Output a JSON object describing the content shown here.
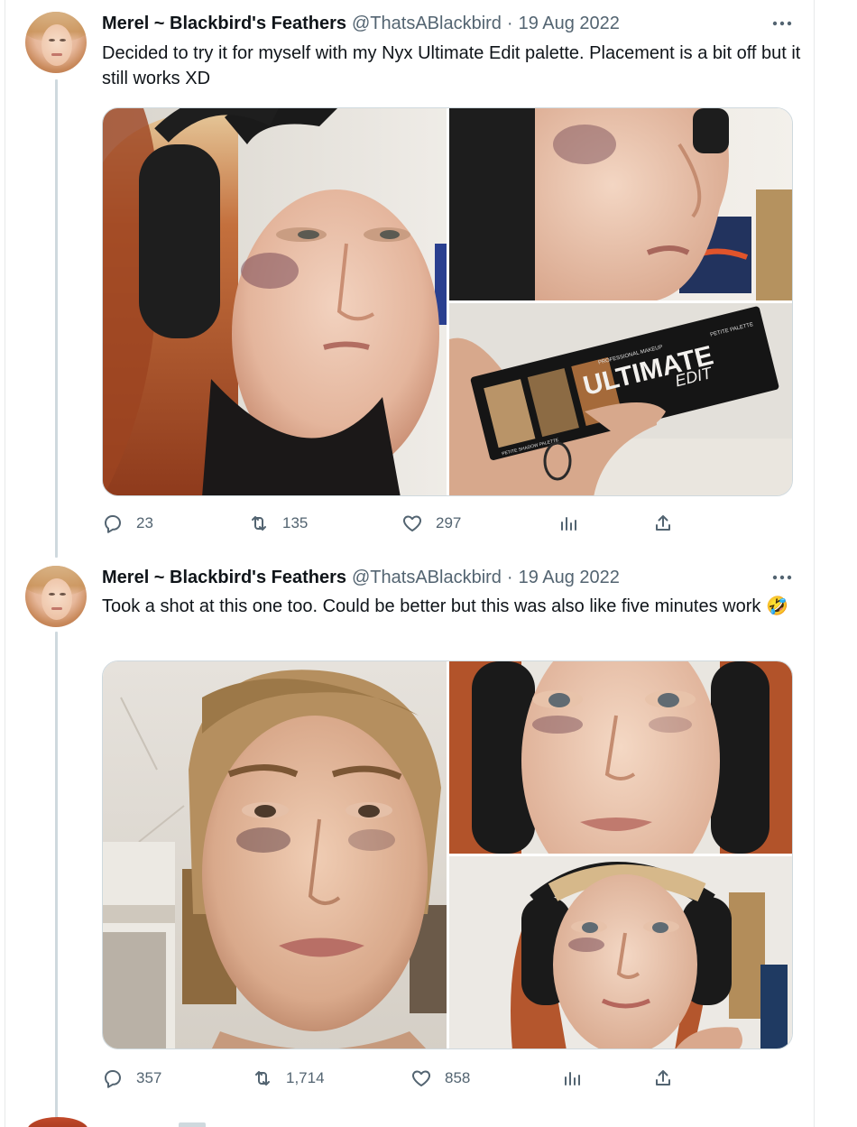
{
  "tweets": [
    {
      "author_name": "Merel ~ Blackbird's Feathers",
      "handle": "@ThatsABlackbird",
      "separator": "·",
      "date": "19 Aug 2022",
      "more_icon": "more-horizontal-icon",
      "text": "Decided to try it for myself with my Nyx Ultimate Edit palette. Placement is a bit off but it still works XD",
      "media": {
        "palette_brand": "PROFESSIONAL MAKEUP",
        "palette_title": "ULTIMATE",
        "palette_subtitle": "EDIT",
        "palette_corner": "PETITE PALETTE",
        "palette_side": "PETITE SHADOW PALETTE"
      },
      "stats": {
        "replies": "23",
        "retweets": "135",
        "likes": "297"
      }
    },
    {
      "author_name": "Merel ~ Blackbird's Feathers",
      "handle": "@ThatsABlackbird",
      "separator": "·",
      "date": "19 Aug 2022",
      "more_icon": "more-horizontal-icon",
      "text": "Took a shot at this one too. Could be better but this was also like five minutes work",
      "emoji": "🤣",
      "stats": {
        "replies": "357",
        "retweets": "1,714",
        "likes": "858"
      }
    }
  ],
  "icons": {
    "reply": "reply-icon",
    "retweet": "retweet-icon",
    "like": "heart-icon",
    "views": "analytics-icon",
    "share": "share-icon"
  },
  "colors": {
    "text_primary": "#0f1419",
    "text_secondary": "#536471",
    "border": "#cfd9de",
    "thread_line": "#cfd9de"
  }
}
